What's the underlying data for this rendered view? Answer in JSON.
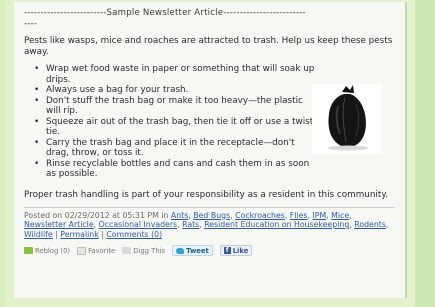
{
  "article": {
    "divider": "-------------------------Sample Newsletter Article-------------------------\n----",
    "intro": "Pests like wasps, mice and roaches are attracted to trash. Help us keep these pests away.",
    "tips": [
      "Wrap wet food waste in paper or something that will soak up drips.",
      "Always use a bag for your trash.",
      "Don't stuff the trash bag or make it too heavy—the plastic will rip.",
      "Squeeze air out of the trash bag, then tie it off or use a twist tie.",
      "Carry the trash bag and place it in the receptacle—don't drag, throw, or toss it.",
      "Rinse recyclable bottles and cans and cash them in as soon as possible."
    ],
    "closing": "Proper trash handling is part of your responsibility as a resident in this community."
  },
  "meta": {
    "posted_prefix": "Posted on 02/29/2012 at 05:31 PM in",
    "categories": [
      "Ants",
      "Bed Bugs",
      "Cockroaches",
      "Flies",
      "IPM",
      "Mice",
      "Newsletter Article",
      "Occasional Invaders",
      "Rats",
      "Resident Education on Housekeeping",
      "Rodents",
      "Wildlife"
    ],
    "permalink": "Permalink",
    "comments": "Comments (0)"
  },
  "share": {
    "reblog": "Reblog (0)",
    "favorite": "Favorite",
    "digg": "Digg This",
    "tweet": "Tweet",
    "like": "Like"
  }
}
